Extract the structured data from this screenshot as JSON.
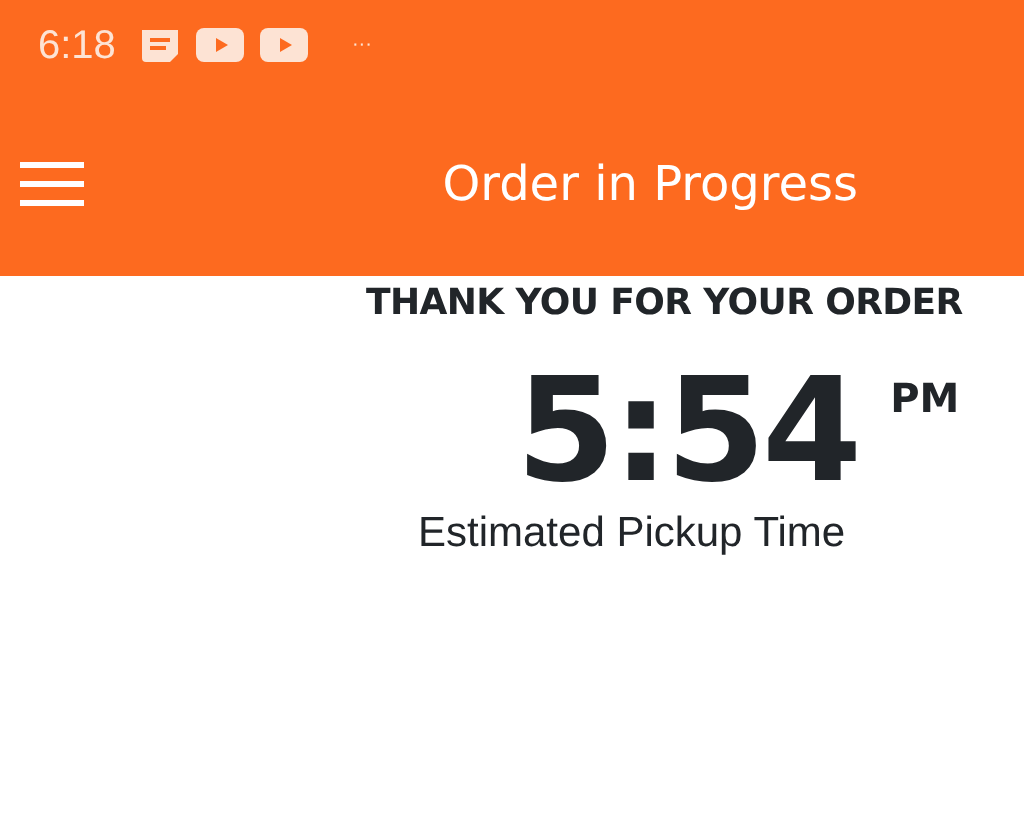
{
  "status_bar": {
    "time": "6:18",
    "more": "···"
  },
  "app_bar": {
    "title": "Order in Progress"
  },
  "confirmation": {
    "heading": "THANK YOU FOR YOUR ORDER",
    "time": "5:54",
    "period": "PM",
    "caption": "Estimated Pickup Time"
  }
}
